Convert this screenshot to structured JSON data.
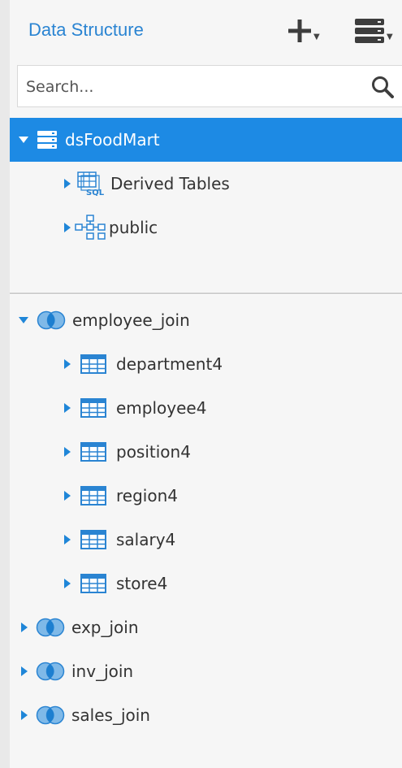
{
  "header": {
    "title": "Data Structure",
    "add_icon": "plus-icon",
    "datasource_icon": "database-stack-icon",
    "accent_color": "#2a84d2"
  },
  "search": {
    "placeholder": "Search...",
    "value": "",
    "icon": "search-icon"
  },
  "datasource": {
    "label": "dsFoodMart",
    "expanded": true,
    "selected": true,
    "selected_color": "#1d8ae4",
    "children": [
      {
        "label": "Derived Tables",
        "icon": "sql-tables-icon",
        "expanded": false
      },
      {
        "label": "public",
        "icon": "schema-tree-icon",
        "expanded": false
      }
    ]
  },
  "joins": [
    {
      "label": "employee_join",
      "expanded": true,
      "children": [
        {
          "label": "department4",
          "icon": "table-icon"
        },
        {
          "label": "employee4",
          "icon": "table-icon"
        },
        {
          "label": "position4",
          "icon": "table-icon"
        },
        {
          "label": "region4",
          "icon": "table-icon"
        },
        {
          "label": "salary4",
          "icon": "table-icon"
        },
        {
          "label": "store4",
          "icon": "table-icon"
        }
      ]
    },
    {
      "label": "exp_join",
      "expanded": false
    },
    {
      "label": "inv_join",
      "expanded": false
    },
    {
      "label": "sales_join",
      "expanded": false
    }
  ]
}
